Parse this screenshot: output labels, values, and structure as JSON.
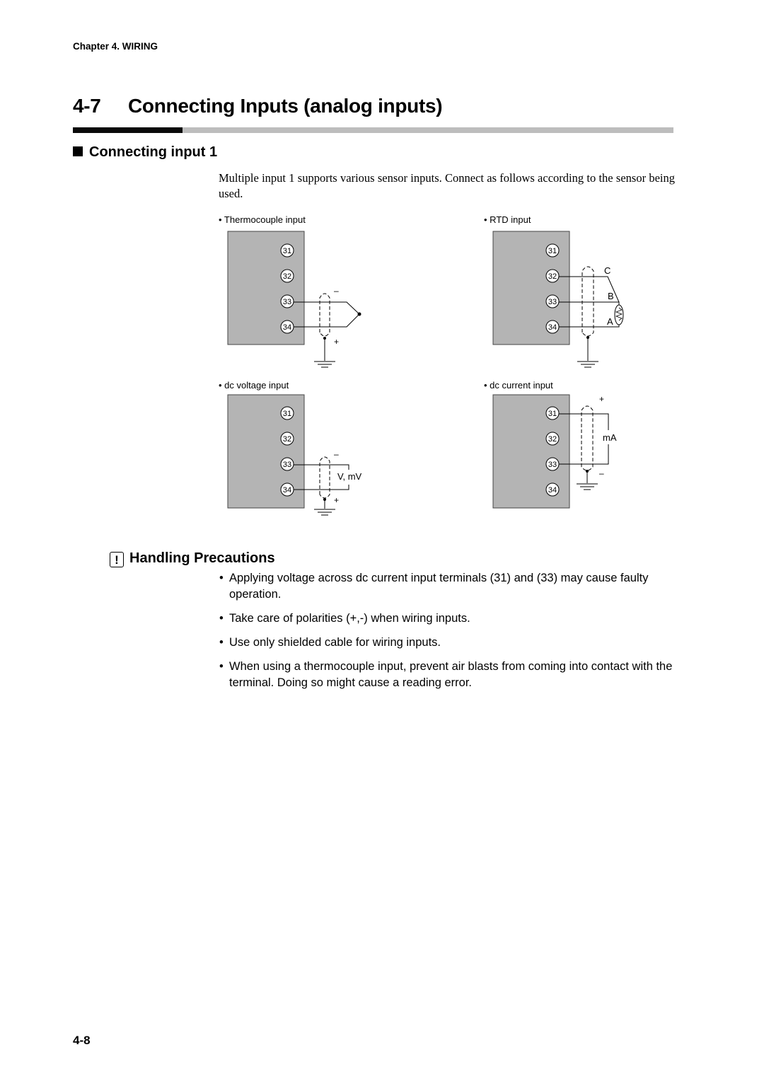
{
  "header": {
    "chapter": "Chapter 4. WIRING"
  },
  "title": {
    "number": "4-7",
    "text": "Connecting Inputs (analog inputs)"
  },
  "section": {
    "heading": "Connecting input 1",
    "intro": "Multiple input 1 supports various sensor inputs. Connect as follows according to the sensor being used."
  },
  "diagrams": [
    {
      "id": "thermocouple",
      "label": "• Thermocouple input",
      "terminals": [
        "31",
        "32",
        "33",
        "34"
      ],
      "minus": "–",
      "plus": "+"
    },
    {
      "id": "rtd",
      "label": "• RTD input",
      "terminals": [
        "31",
        "32",
        "33",
        "34"
      ],
      "wire_labels": [
        "C",
        "B",
        "A"
      ]
    },
    {
      "id": "dc-voltage",
      "label": "• dc voltage input",
      "terminals": [
        "31",
        "32",
        "33",
        "34"
      ],
      "minus": "–",
      "plus": "+",
      "source_label": "V, mV"
    },
    {
      "id": "dc-current",
      "label": "• dc current input",
      "terminals": [
        "31",
        "32",
        "33",
        "34"
      ],
      "minus": "–",
      "plus": "+",
      "source_label": "mA"
    }
  ],
  "precautions": {
    "icon": "!",
    "heading": "Handling Precautions",
    "bullet": "•",
    "items": [
      "Applying voltage across dc current input terminals (31) and (33) may cause faulty operation.",
      "Take care of polarities (+,-) when wiring inputs.",
      "Use only shielded cable for wiring inputs.",
      "When using a thermocouple input, prevent air blasts from coming into contact with the terminal. Doing so might cause a reading error."
    ]
  },
  "footer": {
    "page_number": "4-8"
  },
  "colors": {
    "terminal_block": "#b4b4b4",
    "rule_dark": "#0a0a0a",
    "rule_light": "#bdbdbd"
  }
}
